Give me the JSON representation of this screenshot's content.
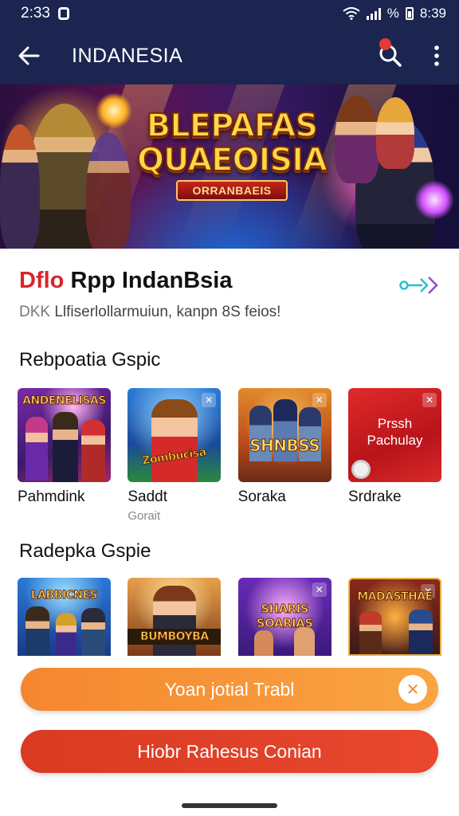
{
  "status_bar": {
    "time": "2:33",
    "right_text": "%",
    "clock": "8:39"
  },
  "app_bar": {
    "title": "INDANESIA",
    "back_icon": "arrow-left-icon",
    "search_icon": "search-icon",
    "more_icon": "more-vert-icon"
  },
  "banner": {
    "line1": "BLEPAFAS",
    "line2": "QUAEOISIA",
    "ribbon": "ORRANBAEIS"
  },
  "info": {
    "title_tag": "Dflo",
    "title": "Rpp IndanBsia",
    "sub_tag": "DKK",
    "subtitle": "Llfiserlollarmuiun, kanpn 8S feios!",
    "arrow_icon": "double-arrow-icon"
  },
  "section1": {
    "title": "Rebpoatia Gspic",
    "cards": [
      {
        "name": "Pahmdink",
        "sub": "",
        "thumb_text": "ANDENELISAS"
      },
      {
        "name": "Saddt",
        "sub": "Gorait",
        "thumb_text": "Zombucisa"
      },
      {
        "name": "Soraka",
        "sub": "",
        "thumb_text": "SHNBSS"
      },
      {
        "name": "Srdrake",
        "sub": "",
        "promo_line1": "Prssh",
        "promo_line2": "Pachulay"
      }
    ]
  },
  "section2": {
    "title": "Radepka Gspie",
    "cards": [
      {
        "thumb_text": "LABBICNES"
      },
      {
        "thumb_text": "BUMBOYBA"
      },
      {
        "thumb_text": "SHARIS SOARIAS"
      },
      {
        "thumb_text": "MADASTHAE"
      }
    ]
  },
  "buttons": {
    "primary": "Yoan jotial Trabl",
    "primary_icon": "x-close-icon",
    "secondary": "Hiobr Rahesus Conian"
  },
  "colors": {
    "header": "#1b2550",
    "accent_red": "#d8262a",
    "btn_orange": "#f5862f",
    "btn_red": "#d93a22"
  }
}
